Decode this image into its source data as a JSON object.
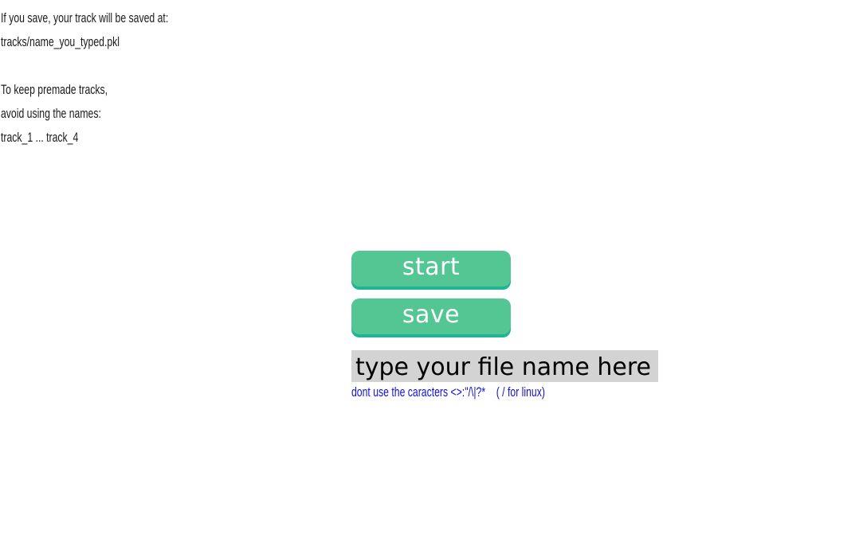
{
  "info": {
    "line1": "If you save, your track will be saved at:",
    "line2": "tracks/name_you_typed.pkl",
    "line3": "To keep premade tracks,",
    "line4": "avoid using the names:",
    "line5": "track_1 ... track_4"
  },
  "buttons": {
    "start_label": "start",
    "save_label": "save"
  },
  "filename_input": {
    "value": "type your file name here"
  },
  "warning": {
    "text": "dont use the caracters <>:\"/\\|?*    ( / for linux)"
  },
  "colors": {
    "button_fill": "#54c693",
    "button_shadow": "#20b497",
    "input_background": "#d3d3d3",
    "warning_text": "#1010d8"
  }
}
